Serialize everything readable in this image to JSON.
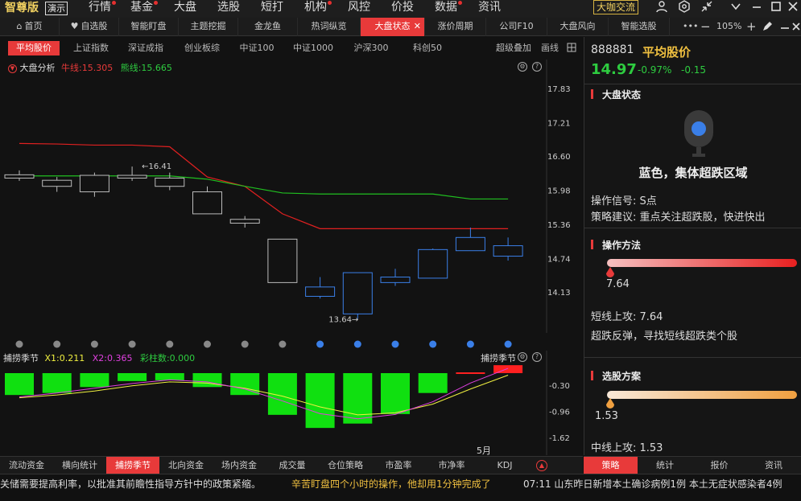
{
  "topbar": {
    "logo": "智尊版",
    "demo": "演示",
    "menu": [
      {
        "label": "行情",
        "dot": true
      },
      {
        "label": "基金",
        "dot": true
      },
      {
        "label": "大盘",
        "dot": false
      },
      {
        "label": "选股",
        "dot": false
      },
      {
        "label": "短打",
        "dot": false
      },
      {
        "label": "机构",
        "dot": true
      },
      {
        "label": "风控",
        "dot": false
      },
      {
        "label": "价投",
        "dot": false
      },
      {
        "label": "数据",
        "dot": true
      },
      {
        "label": "资讯",
        "dot": false
      }
    ],
    "coffee": "大咖交流",
    "icons": [
      "user-icon",
      "settings-icon",
      "shrink-icon",
      "chevron-down-icon",
      "minimize-icon",
      "maximize-icon",
      "close-icon"
    ]
  },
  "tabs": [
    {
      "label": "首页",
      "icon": "home-icon"
    },
    {
      "label": "自选股",
      "icon": "heart-icon"
    },
    {
      "label": "智能盯盘"
    },
    {
      "label": "主题挖掘"
    },
    {
      "label": "金龙鱼"
    },
    {
      "label": "热词纵览"
    },
    {
      "label": "大盘状态",
      "active": true,
      "close": "✕"
    },
    {
      "label": "涨价周期"
    },
    {
      "label": "公司F10"
    },
    {
      "label": "大盘风向"
    },
    {
      "label": "智能选股"
    }
  ],
  "zoom": {
    "more": "•••",
    "minus": "−",
    "value": "105%",
    "plus": "+"
  },
  "subtabs": [
    "平均股价",
    "上证指数",
    "深证成指",
    "创业板综",
    "中证100",
    "中证1000",
    "沪深300",
    "科创50"
  ],
  "subtabs_right": {
    "overlay": "超级叠加",
    "draw": "画线"
  },
  "chart_header": {
    "title": "大盘分析",
    "bull": "牛线:15.305",
    "bear": "熊线:15.665"
  },
  "chart_data": {
    "type": "candlestick",
    "yaxis_ticks": [
      "17.83",
      "17.21",
      "16.60",
      "15.98",
      "15.36",
      "14.74",
      "14.13"
    ],
    "yaxis_values": [
      17.83,
      17.21,
      16.6,
      15.98,
      15.36,
      14.74,
      14.13
    ],
    "candles": [
      {
        "o": 16.26,
        "c": 16.2,
        "h": 16.34,
        "l": 16.15,
        "color": "gray"
      },
      {
        "o": 16.16,
        "c": 16.05,
        "h": 16.22,
        "l": 15.95,
        "color": "gray"
      },
      {
        "o": 16.25,
        "c": 15.95,
        "h": 16.3,
        "l": 15.86,
        "color": "gray"
      },
      {
        "o": 16.25,
        "c": 16.2,
        "h": 16.41,
        "l": 16.15,
        "color": "gray"
      },
      {
        "o": 16.2,
        "c": 16.05,
        "h": 16.3,
        "l": 15.98,
        "color": "gray"
      },
      {
        "o": 15.95,
        "c": 15.55,
        "h": 16.05,
        "l": 15.55,
        "color": "gray"
      },
      {
        "o": 15.45,
        "c": 15.38,
        "h": 15.51,
        "l": 15.3,
        "color": "gray"
      },
      {
        "o": 15.09,
        "c": 14.3,
        "h": 15.09,
        "l": 14.3,
        "color": "gray"
      },
      {
        "o": 14.05,
        "c": 14.22,
        "h": 14.4,
        "l": 14.01,
        "color": "blue"
      },
      {
        "o": 13.73,
        "c": 14.48,
        "h": 14.48,
        "l": 13.64,
        "color": "blue"
      },
      {
        "o": 14.3,
        "c": 14.4,
        "h": 14.55,
        "l": 14.24,
        "color": "blue"
      },
      {
        "o": 14.38,
        "c": 14.9,
        "h": 14.92,
        "l": 14.38,
        "color": "blue"
      },
      {
        "o": 14.88,
        "c": 15.12,
        "h": 15.3,
        "l": 14.88,
        "color": "blue"
      },
      {
        "o": 14.78,
        "c": 14.97,
        "h": 15.12,
        "l": 14.7,
        "color": "blue"
      }
    ],
    "red_line": [
      16.83,
      16.82,
      16.8,
      16.8,
      16.77,
      16.22,
      16.05,
      15.55,
      15.28,
      15.28,
      15.28,
      15.28,
      15.28,
      15.28
    ],
    "green_line": [
      16.24,
      16.24,
      16.24,
      16.24,
      16.24,
      16.18,
      16.05,
      15.93,
      15.91,
      15.91,
      15.91,
      15.91,
      15.82,
      15.82
    ],
    "high_label": "16.41",
    "low_label": "13.64",
    "dots": [
      "gray",
      "gray",
      "gray",
      "gray",
      "gray",
      "gray",
      "gray",
      "gray",
      "blue",
      "blue",
      "blue",
      "blue",
      "blue",
      "blue"
    ]
  },
  "indicator": {
    "title": "捕捞季节",
    "x1": "X1:0.211",
    "x2": "X2:0.365",
    "bars_label": "彩柱数:0.000",
    "right_title": "捕捞季节",
    "ticks": [
      "-0.30",
      "-0.96",
      "-1.62"
    ],
    "tick_values": [
      -0.3,
      -0.96,
      -1.62
    ],
    "bars": [
      -0.55,
      -0.5,
      -0.35,
      -0.2,
      -0.18,
      -0.35,
      -0.55,
      -1.05,
      -1.38,
      -1.27,
      -1.03,
      -0.5,
      0.02,
      0.2
    ],
    "month_label": "5月"
  },
  "bottom_tabs": [
    "流动资金",
    "横向统计",
    "捕捞季节",
    "北向资金",
    "场内资金",
    "成交量",
    "仓位策略",
    "市盈率",
    "市净率",
    "KDJ"
  ],
  "ticker": {
    "items": [
      {
        "text": "关储需要提高利率，以批准其前瞻性指导方针中的政策紧缩。",
        "color": "#ddd"
      },
      {
        "text": "辛苦盯盘四个小时的操作，他却用1分钟完成了",
        "color": "#f0c040"
      },
      {
        "text": "07:11 山东昨日新增本土确诊病例1例 本土无症状感染者4例",
        "color": "#ddd"
      }
    ]
  },
  "right": {
    "code": "888881",
    "name": "平均股价",
    "price": "14.97",
    "pct": "-0.97%",
    "change": "-0.15",
    "state_title": "大盘状态",
    "state_text": "蓝色，集体超跌区域",
    "signal": "操作信号: S点",
    "advice": "策略建议: 重点关注超跌股，快进快出",
    "method_title": "操作方法",
    "method_value": "7.64",
    "method_line1": "短线上攻: 7.64",
    "method_line2": "超跌反弹，寻找短线超跌类个股",
    "pick_title": "选股方案",
    "pick_value": "1.53",
    "pick_line1": "中线上攻: 1.53",
    "colors": {
      "red": "#e83a3a",
      "green": "#2ecc40",
      "gold": "#f0c040",
      "blue": "#3a7fe8"
    }
  },
  "right_tabs": [
    "策略",
    "统计",
    "报价",
    "资讯"
  ]
}
